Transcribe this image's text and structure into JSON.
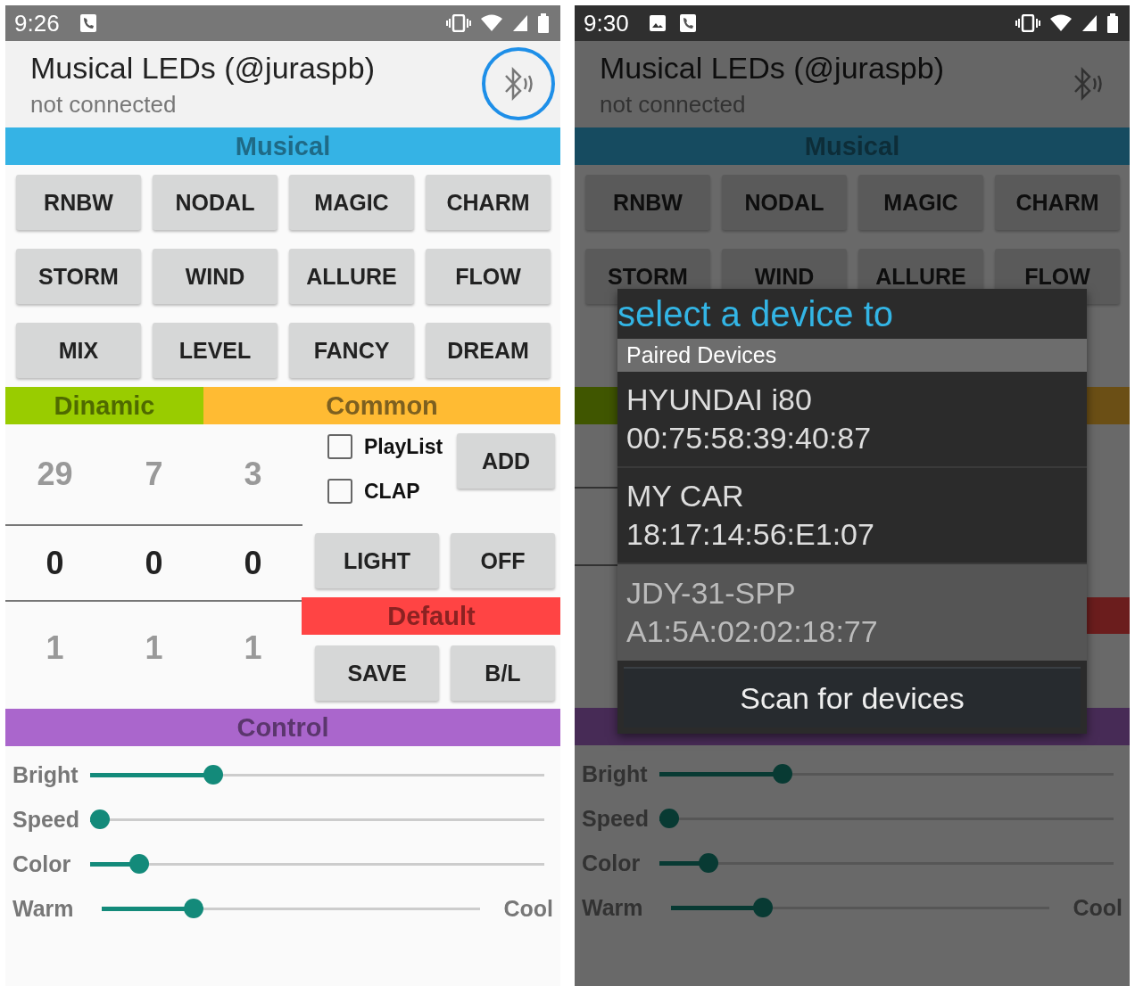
{
  "screens": [
    {
      "status_bar": {
        "time": "9:26",
        "dark": false,
        "notification_icons": [
          {
            "kind": "voip"
          }
        ]
      },
      "dimmed": false,
      "app_bar": {
        "title": "Musical LEDs (@juraspb)",
        "subtitle": "not connected",
        "bluetooth_highlighted": true
      },
      "musical": {
        "label": "Musical",
        "rows": [
          [
            "RNBW",
            "NODAL",
            "MAGIC",
            "CHARM"
          ],
          [
            "STORM",
            "WIND",
            "ALLURE",
            "FLOW"
          ],
          [
            "MIX",
            "LEVEL",
            "FANCY",
            "DREAM"
          ]
        ]
      },
      "dinamic": {
        "label": "Dinamic",
        "pickers": [
          {
            "above": "29",
            "value": "0",
            "below": "1"
          },
          {
            "above": "7",
            "value": "0",
            "below": "1"
          },
          {
            "above": "3",
            "value": "0",
            "below": "1"
          }
        ]
      },
      "common": {
        "label": "Common",
        "checkboxes": [
          {
            "label": "PlayList",
            "checked": false
          },
          {
            "label": "CLAP",
            "checked": false
          }
        ],
        "add_button": "ADD",
        "buttons": [
          "LIGHT",
          "OFF"
        ]
      },
      "default": {
        "label": "Default",
        "buttons": [
          "SAVE",
          "B/L"
        ]
      },
      "control": {
        "label": "Control",
        "sliders": [
          {
            "label": "Bright",
            "level": 0.26
          },
          {
            "label": "Speed",
            "level": 0
          },
          {
            "label": "Color",
            "level": 0.09
          },
          {
            "label": "Warm",
            "level": 0.23,
            "end_label": "Cool"
          }
        ]
      }
    },
    {
      "status_bar": {
        "time": "9:30",
        "dark": true,
        "notification_icons": [
          {
            "kind": "image"
          },
          {
            "kind": "voip"
          }
        ]
      },
      "dimmed": true,
      "app_bar": {
        "title": "Musical LEDs (@juraspb)",
        "subtitle": "not connected",
        "bluetooth_highlighted": false
      },
      "musical": {
        "label": "Musical",
        "rows": [
          [
            "RNBW",
            "NODAL",
            "MAGIC",
            "CHARM"
          ],
          [
            "STORM",
            "WIND",
            "ALLURE",
            "FLOW"
          ]
        ]
      },
      "control": {
        "sliders": [
          {
            "label": "Bright",
            "level": 0.26
          },
          {
            "label": "Speed",
            "level": 0
          },
          {
            "label": "Color",
            "level": 0.09
          },
          {
            "label": "Warm",
            "level": 0.23,
            "end_label": "Cool"
          }
        ]
      },
      "dialog": {
        "title": "select a device to",
        "section": "Paired Devices",
        "devices": [
          {
            "name": "HYUNDAI i80",
            "address": "00:75:58:39:40:87",
            "selected": false
          },
          {
            "name": "MY CAR",
            "address": "18:17:14:56:E1:07",
            "selected": false
          },
          {
            "name": "JDY-31-SPP",
            "address": "A1:5A:02:02:18:77",
            "selected": true
          }
        ],
        "scan_button": "Scan for devices"
      }
    }
  ]
}
